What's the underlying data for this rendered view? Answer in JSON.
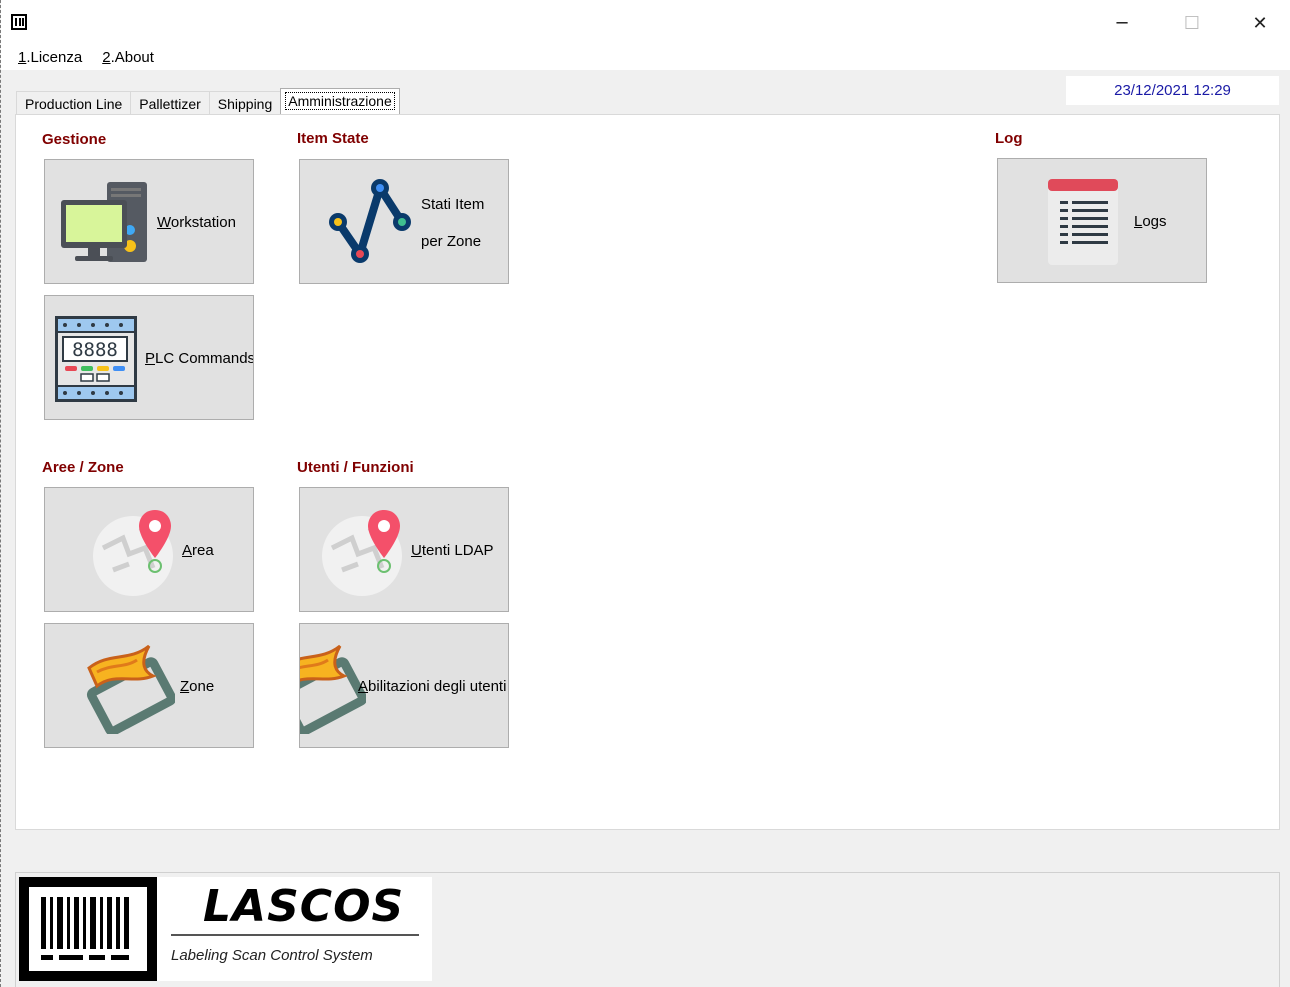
{
  "window": {
    "app_icon": "barcode-icon",
    "minimize_glyph": "─",
    "maximize_glyph": "☐",
    "close_glyph": "✕"
  },
  "menu": {
    "items": [
      {
        "accel": "1",
        "rest": ".Licenza"
      },
      {
        "accel": "2",
        "rest": ".About"
      }
    ]
  },
  "tabs": [
    "Production Line",
    "Pallettizer",
    "Shipping",
    "Amministrazione"
  ],
  "active_tab": "Amministrazione",
  "datetime": "23/12/2021   12:29",
  "sections": {
    "gestione": "Gestione",
    "item_state": "Item State",
    "log": "Log",
    "aree_zone": "Aree / Zone",
    "utenti_funzioni": "Utenti / Funzioni"
  },
  "buttons": {
    "workstation": {
      "accel": "W",
      "rest": "orkstation",
      "icon": "workstation-icon"
    },
    "plc_commands": {
      "accel": "P",
      "rest": "LC Commands",
      "icon": "plc-icon"
    },
    "stati_item": {
      "line1": "Stati Item",
      "line2": "per Zone",
      "icon": "graph-icon"
    },
    "logs": {
      "accel": "L",
      "rest": "ogs",
      "icon": "log-list-icon"
    },
    "area": {
      "accel": "A",
      "rest": "rea",
      "icon": "map-pin-icon"
    },
    "utenti_ldap": {
      "accel": "U",
      "rest": "tenti LDAP",
      "icon": "map-pin-icon"
    },
    "zone": {
      "accel": "Z",
      "rest": "one",
      "icon": "flag-icon"
    },
    "abilitazioni": {
      "accel": "A",
      "rest": "bilitazioni degli utenti",
      "icon": "flag-icon"
    }
  },
  "logo": {
    "title": "LASCOS",
    "subtitle": "Labeling Scan Control System"
  },
  "colors": {
    "section_title": "#800000",
    "datetime": "#1a1aa6",
    "button_face": "#e1e1e1"
  }
}
